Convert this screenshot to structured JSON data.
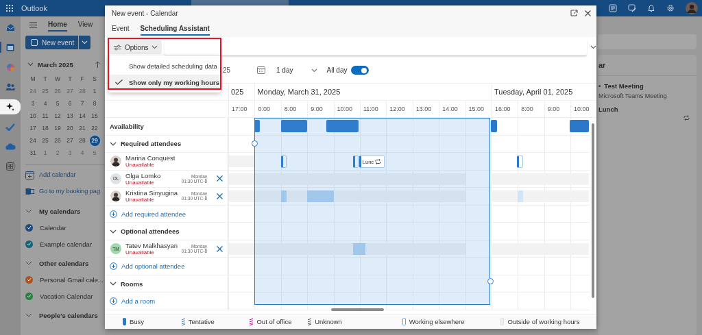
{
  "app_bar": {
    "app_name": "Outlook"
  },
  "nav_rail": [
    {
      "kind": "mail",
      "selected": false,
      "highlighted": false
    },
    {
      "kind": "calendar",
      "selected": true,
      "highlighted": false
    },
    {
      "kind": "copilot",
      "selected": false,
      "highlighted": false
    },
    {
      "kind": "people",
      "selected": false,
      "highlighted": false
    },
    {
      "kind": "sparkle",
      "selected": false,
      "highlighted": true
    },
    {
      "kind": "todo",
      "selected": false,
      "highlighted": false
    },
    {
      "kind": "cloud",
      "selected": false,
      "highlighted": false
    },
    {
      "kind": "apps",
      "selected": false,
      "highlighted": false
    }
  ],
  "ribbon": {
    "tabs": [
      {
        "label": "Home",
        "selected": true
      },
      {
        "label": "View",
        "selected": false
      }
    ],
    "new_event": "New event"
  },
  "mini_calendar": {
    "title": "March 2025",
    "weekdays": [
      "M",
      "T",
      "W",
      "T",
      "F",
      "S"
    ],
    "weeks": [
      [
        {
          "day": "24",
          "other_month": true,
          "selected": false
        },
        {
          "day": "25",
          "other_month": true,
          "selected": false
        },
        {
          "day": "26",
          "other_month": true,
          "selected": false
        },
        {
          "day": "27",
          "other_month": true,
          "selected": false
        },
        {
          "day": "28",
          "other_month": true,
          "selected": false
        },
        {
          "day": "1",
          "other_month": false,
          "selected": false
        }
      ],
      [
        {
          "day": "3",
          "other_month": false,
          "selected": false
        },
        {
          "day": "4",
          "other_month": false,
          "selected": false
        },
        {
          "day": "5",
          "other_month": false,
          "selected": false
        },
        {
          "day": "6",
          "other_month": false,
          "selected": false
        },
        {
          "day": "7",
          "other_month": false,
          "selected": false
        },
        {
          "day": "8",
          "other_month": false,
          "selected": false
        }
      ],
      [
        {
          "day": "10",
          "other_month": false,
          "selected": false
        },
        {
          "day": "11",
          "other_month": false,
          "selected": false
        },
        {
          "day": "12",
          "other_month": false,
          "selected": false
        },
        {
          "day": "13",
          "other_month": false,
          "selected": false
        },
        {
          "day": "14",
          "other_month": false,
          "selected": false
        },
        {
          "day": "15",
          "other_month": false,
          "selected": false
        }
      ],
      [
        {
          "day": "17",
          "other_month": false,
          "selected": false
        },
        {
          "day": "18",
          "other_month": false,
          "selected": false
        },
        {
          "day": "19",
          "other_month": false,
          "selected": false
        },
        {
          "day": "20",
          "other_month": false,
          "selected": false
        },
        {
          "day": "21",
          "other_month": false,
          "selected": false
        },
        {
          "day": "22",
          "other_month": false,
          "selected": false
        }
      ],
      [
        {
          "day": "24",
          "other_month": false,
          "selected": false
        },
        {
          "day": "25",
          "other_month": false,
          "selected": false
        },
        {
          "day": "26",
          "other_month": false,
          "selected": false
        },
        {
          "day": "27",
          "other_month": false,
          "selected": false
        },
        {
          "day": "28",
          "other_month": false,
          "selected": false
        },
        {
          "day": "29",
          "other_month": false,
          "selected": true
        }
      ],
      [
        {
          "day": "31",
          "other_month": false,
          "selected": false
        },
        {
          "day": "1",
          "other_month": true,
          "selected": false
        },
        {
          "day": "2",
          "other_month": true,
          "selected": false
        },
        {
          "day": "3",
          "other_month": true,
          "selected": false
        },
        {
          "day": "4",
          "other_month": true,
          "selected": false
        },
        {
          "day": "5",
          "other_month": true,
          "selected": false
        }
      ]
    ]
  },
  "sidebar_links": [
    {
      "kind": "add_calendar",
      "label": "Add calendar"
    },
    {
      "kind": "booking",
      "label": "Go to my booking pag"
    }
  ],
  "calendar_groups": [
    {
      "title": "My calendars",
      "expanded": true,
      "calendars": [
        {
          "name": "Calendar",
          "color": "#1b4b80",
          "checked": true
        },
        {
          "name": "Example calendar",
          "color": "#13647a",
          "checked": true
        }
      ]
    },
    {
      "title": "Other calendars",
      "expanded": true,
      "calendars": [
        {
          "name": "Personal Gmail cale...",
          "color": "#b14f1d",
          "checked": true
        },
        {
          "name": "Vacation Calendar",
          "color": "#23843c",
          "checked": true
        }
      ]
    },
    {
      "title": "People's calendars",
      "expanded": true
    }
  ],
  "dialog": {
    "title": "New event - Calendar",
    "tabs": [
      {
        "label": "Event",
        "selected": false
      },
      {
        "label": "Scheduling Assistant",
        "selected": true
      }
    ],
    "options_button": "Options",
    "options_menu": [
      {
        "label": "Show detailed scheduling data",
        "checked": false
      },
      {
        "label": "Show only my working hours",
        "checked": true
      }
    ],
    "date_field": "25",
    "duration": "1 day",
    "all_day": {
      "label": "All day",
      "on": true
    },
    "date_headers": [
      "025",
      "Monday, March 31, 2025",
      "Tuesday, April 01, 2025"
    ],
    "hours": [
      "17:00",
      "0:00",
      "8:00",
      "9:00",
      "10:00",
      "11:00",
      "12:00",
      "13:00",
      "14:00",
      "15:00",
      "16:00",
      "8:00",
      "9:00",
      "10:00"
    ],
    "rows": [
      {
        "kind": "heading",
        "label": "Availability"
      },
      {
        "kind": "section",
        "label": "Required attendees",
        "expanded": true
      },
      {
        "kind": "person",
        "name": "Marina Conquest",
        "status": "Unavailable",
        "avatar": {
          "kind": "photo"
        }
      },
      {
        "kind": "person",
        "name": "Olga Lomko",
        "status": "Unavailable",
        "avatar": {
          "kind": "initials",
          "initials": "OL",
          "color": "#dfe3e7"
        },
        "day": "Monday",
        "time": "01:30 UTC-8",
        "removable": true
      },
      {
        "kind": "person",
        "name": "Kristina Sinyugina",
        "status": "Unavailable",
        "avatar": {
          "kind": "photo"
        },
        "day": "Monday",
        "time": "01:30 UTC-8",
        "removable": true
      },
      {
        "kind": "add",
        "label": "Add required attendee"
      },
      {
        "kind": "section",
        "label": "Optional attendees",
        "expanded": true
      },
      {
        "kind": "person",
        "name": "Tatev Malkhasyan",
        "status": "Unavailable",
        "avatar": {
          "kind": "initials",
          "initials": "TM",
          "color": "#9fd8a9"
        },
        "day": "Monday",
        "time": "01:30 UTC-8",
        "removable": true
      },
      {
        "kind": "add",
        "label": "Add optional attendee"
      },
      {
        "kind": "section",
        "label": "Rooms",
        "expanded": true
      },
      {
        "kind": "add",
        "label": "Add a room"
      }
    ],
    "lunch_event": {
      "label": "Lunc",
      "recurring": true
    },
    "legend": [
      {
        "kind": "busy",
        "label": "Busy"
      },
      {
        "kind": "tentative",
        "label": "Tentative"
      },
      {
        "kind": "out_of_office",
        "label": "Out of office"
      },
      {
        "kind": "unknown",
        "label": "Unknown"
      },
      {
        "kind": "working_elsewhere",
        "label": "Working elsewhere"
      },
      {
        "kind": "outside_hours",
        "label": "Outside of working hours"
      }
    ]
  },
  "right_panel": {
    "heading": "ar",
    "events": [
      {
        "bullet": "•",
        "title": "Test Meeting",
        "subtitle": "Microsoft Teams Meeting",
        "recurring": false
      },
      {
        "title": "Lunch",
        "recurring": true
      }
    ]
  }
}
